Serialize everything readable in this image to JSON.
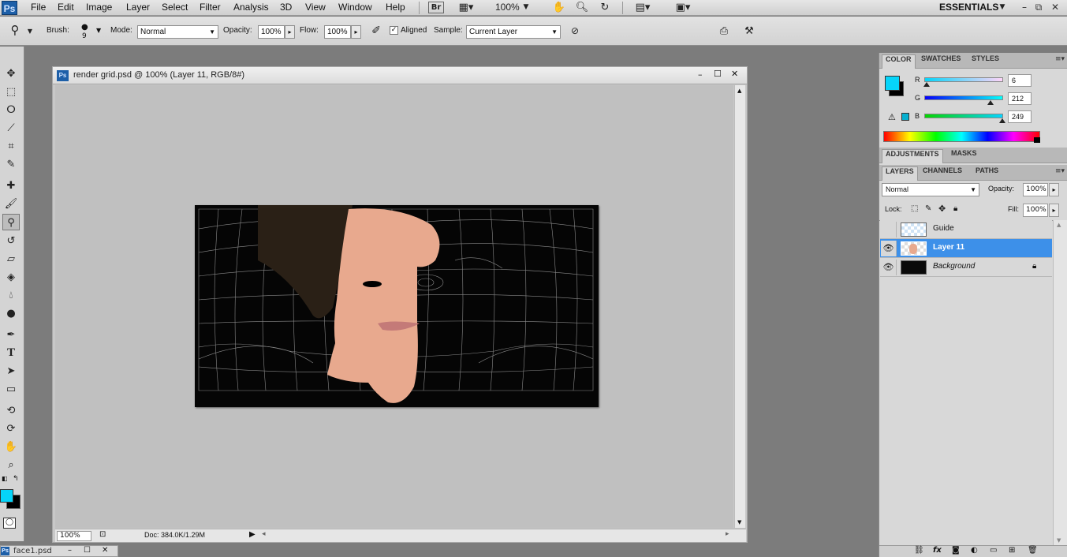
{
  "menu": {
    "items": [
      "File",
      "Edit",
      "Image",
      "Layer",
      "Select",
      "Filter",
      "Analysis",
      "3D",
      "View",
      "Window",
      "Help"
    ],
    "bridge_label": "Br",
    "zoom_level": "100%",
    "workspace": "ESSENTIALS"
  },
  "options": {
    "brush_label": "Brush:",
    "brush_size": "9",
    "mode_label": "Mode:",
    "mode_value": "Normal",
    "opacity_label": "Opacity:",
    "opacity_value": "100%",
    "flow_label": "Flow:",
    "flow_value": "100%",
    "aligned_label": "Aligned",
    "aligned_checked": true,
    "sample_label": "Sample:",
    "sample_value": "Current Layer"
  },
  "document": {
    "title": "render grid.psd @ 100% (Layer 11, RGB/8#)",
    "zoom": "100%",
    "doc_info": "Doc: 384.0K/1.29M"
  },
  "taskbar": {
    "title": "face1.psd"
  },
  "color_panel": {
    "tabs": [
      "COLOR",
      "SWATCHES",
      "STYLES"
    ],
    "r_label": "R",
    "g_label": "G",
    "b_label": "B",
    "r_value": "6",
    "g_value": "212",
    "b_value": "249",
    "r": 6,
    "g": 212,
    "b": 249,
    "foreground_color": "#06d4f9",
    "background_color": "#000000"
  },
  "adjust_panel": {
    "tabs": [
      "ADJUSTMENTS",
      "MASKS"
    ]
  },
  "layers_panel": {
    "tabs": [
      "LAYERS",
      "CHANNELS",
      "PATHS"
    ],
    "blend_mode": "Normal",
    "opacity_label": "Opacity:",
    "opacity_value": "100%",
    "lock_label": "Lock:",
    "fill_label": "Fill:",
    "fill_value": "100%",
    "layers": [
      {
        "name": "Guide",
        "visible": false,
        "selected": false
      },
      {
        "name": "Layer 11",
        "visible": true,
        "selected": true
      },
      {
        "name": "Background",
        "visible": true,
        "selected": false,
        "locked": true
      }
    ]
  }
}
